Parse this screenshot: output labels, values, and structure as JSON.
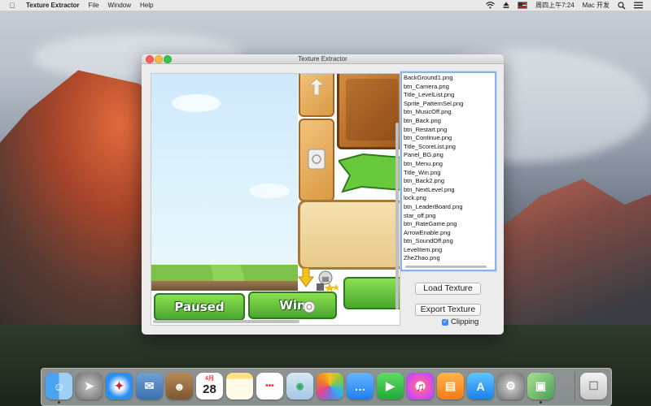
{
  "menubar": {
    "app_name": "Texture Extractor",
    "menus": [
      "File",
      "Window",
      "Help"
    ],
    "status": {
      "clock": "周四上午7:24",
      "user": "Mac 开发"
    }
  },
  "window": {
    "title": "Texture Extractor",
    "files": [
      "BackGround1.png",
      "btn_Camera.png",
      "Title_LevelList.png",
      "Sprite_PatternSel.png",
      "btn_MusicOff.png",
      "btn_Back.png",
      "btn_Restart.png",
      "btn_Continue.png",
      "Title_ScoreList.png",
      "Panel_BG.png",
      "btn_Menu.png",
      "Title_Win.png",
      "btn_Back2.png",
      "btn_NextLevel.png",
      "lock.png",
      "btn_LeaderBoard.png",
      "star_off.png",
      "btn_RateGame.png",
      "ArrowEnable.png",
      "btn_SoundOff.png",
      "LevelItem.png",
      "ZheZhao.png"
    ],
    "buttons": {
      "load": "Load Texture",
      "export": "Export Texture"
    },
    "clipping": {
      "label": "Clipping",
      "checked": true
    },
    "preview": {
      "paused_text": "Paused",
      "win_text": "Win"
    }
  },
  "dock": {
    "calendar_month": "4月",
    "calendar_day": "28"
  },
  "colors": {
    "accent": "#3b8cf6",
    "list_border": "#8ab2e6"
  }
}
